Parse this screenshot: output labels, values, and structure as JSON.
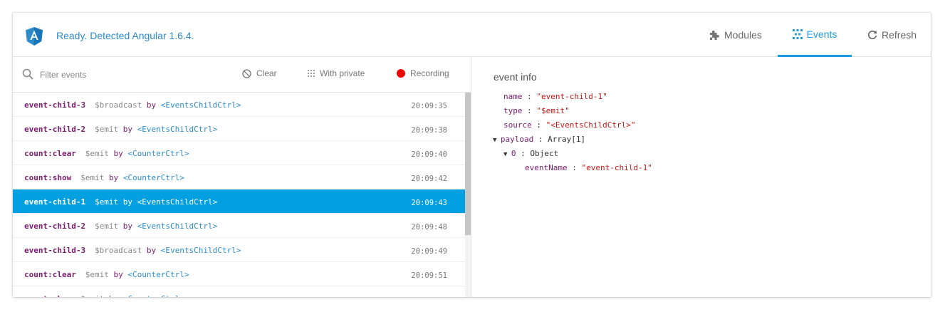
{
  "header": {
    "status": "Ready. Detected Angular 1.6.4.",
    "tabs": {
      "modules": "Modules",
      "events": "Events",
      "refresh": "Refresh"
    }
  },
  "toolbar": {
    "search_placeholder": "Filter events",
    "clear": "Clear",
    "with_private": "With private",
    "recording": "Recording"
  },
  "events": [
    {
      "name": "event-child-3",
      "type": "$broadcast",
      "by": "by",
      "target": "<EventsChildCtrl>",
      "time": "20:09:35"
    },
    {
      "name": "event-child-2",
      "type": "$emit",
      "by": "by",
      "target": "<EventsChildCtrl>",
      "time": "20:09:38"
    },
    {
      "name": "count:clear",
      "type": "$emit",
      "by": "by",
      "target": "<CounterCtrl>",
      "time": "20:09:40"
    },
    {
      "name": "count:show",
      "type": "$emit",
      "by": "by",
      "target": "<CounterCtrl>",
      "time": "20:09:42"
    },
    {
      "name": "event-child-1",
      "type": "$emit",
      "by": "by",
      "target": "<EventsChildCtrl>",
      "time": "20:09:43",
      "selected": true
    },
    {
      "name": "event-child-2",
      "type": "$emit",
      "by": "by",
      "target": "<EventsChildCtrl>",
      "time": "20:09:48"
    },
    {
      "name": "event-child-3",
      "type": "$broadcast",
      "by": "by",
      "target": "<EventsChildCtrl>",
      "time": "20:09:49"
    },
    {
      "name": "count:clear",
      "type": "$emit",
      "by": "by",
      "target": "<CounterCtrl>",
      "time": "20:09:51"
    },
    {
      "name": "count:show",
      "type": "$emit",
      "by": "by",
      "target": "<CounterCtrl>",
      "time": ""
    }
  ],
  "event_info": {
    "title": "event info",
    "name_key": "name",
    "name_val": "\"event-child-1\"",
    "type_key": "type",
    "type_val": "\"$emit\"",
    "source_key": "source",
    "source_val": "\"<EventsChildCtrl>\"",
    "payload_key": "payload",
    "payload_val": "Array[1]",
    "item_key": "0",
    "item_val": "Object",
    "eventname_key": "eventName",
    "eventname_val": "\"event-child-1\"",
    "sep": " : "
  },
  "colors": {
    "accent": "#1e9be0",
    "selected_row": "#029fe1",
    "recording": "#f20000",
    "key": "#7a1c6e",
    "string": "#c41a16",
    "link": "#2e8ccb"
  }
}
